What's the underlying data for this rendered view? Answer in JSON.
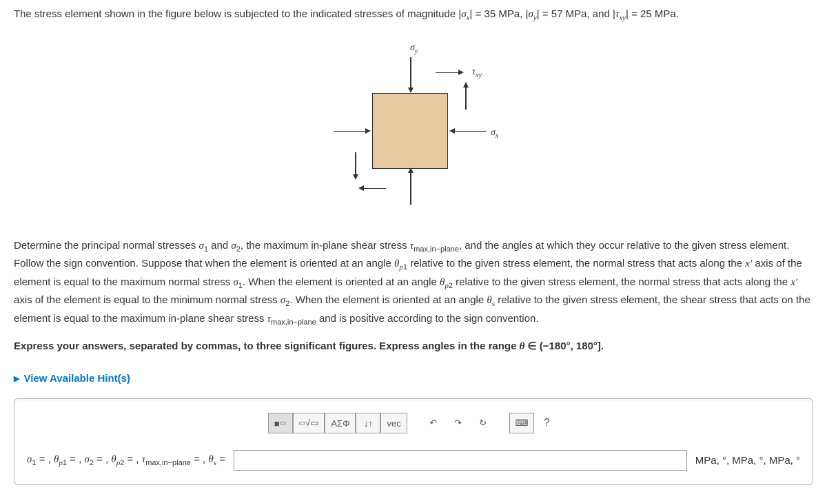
{
  "problem": {
    "statement": "The stress element shown in the figure below is subjected to the indicated stresses of magnitude |σₓ| = 35 MPa, |σ_y| = 57 MPa, and |τ_xy| = 25 MPa."
  },
  "figure": {
    "label_sigma_y": "σ",
    "label_sigma_y_sub": "y",
    "label_sigma_x": "σ",
    "label_sigma_x_sub": "x",
    "label_tau": "τ",
    "label_tau_sub": "xy"
  },
  "instructions": {
    "main": "Determine the principal normal stresses σ₁ and σ₂, the maximum in-plane shear stress τ_max,in−plane, and the angles at which they occur relative to the given stress element. Follow the sign convention. Suppose that when the element is oriented at an angle θ_p1 relative to the given stress element, the normal stress that acts along the x′ axis of the element is equal to the maximum normal stress σ₁. When the element is oriented at an angle θ_p2 relative to the given stress element, the normal stress that acts along the x′ axis of the element is equal to the minimum normal stress σ₂. When the element is oriented at an angle θ_s relative to the given stress element, the shear stress that acts on the element is equal to the maximum in-plane shear stress τ_max,in−plane and is positive according to the sign convention.",
    "format": "Express your answers, separated by commas, to three significant figures. Express angles in the range θ ∈ (−180°, 180°]."
  },
  "hints_link": "View Available Hint(s)",
  "toolbar": {
    "templates": "▭",
    "math_root": "√▭",
    "greek": "ΑΣΦ",
    "subscript": "↓↑",
    "vec": "vec",
    "undo": "↶",
    "redo": "↷",
    "reset": "↻",
    "keyboard": "⌨",
    "help": "?"
  },
  "answer": {
    "lhs_sigma1": "σ",
    "lhs_eq": " = ,",
    "lhs_theta_p1": "θ",
    "lhs_sigma2": "σ",
    "lhs_theta_p2": "θ",
    "lhs_tau": "τ",
    "lhs_theta_s": "θ",
    "input_value": "",
    "rhs": "MPa, °, MPa, °, MPa, °"
  }
}
